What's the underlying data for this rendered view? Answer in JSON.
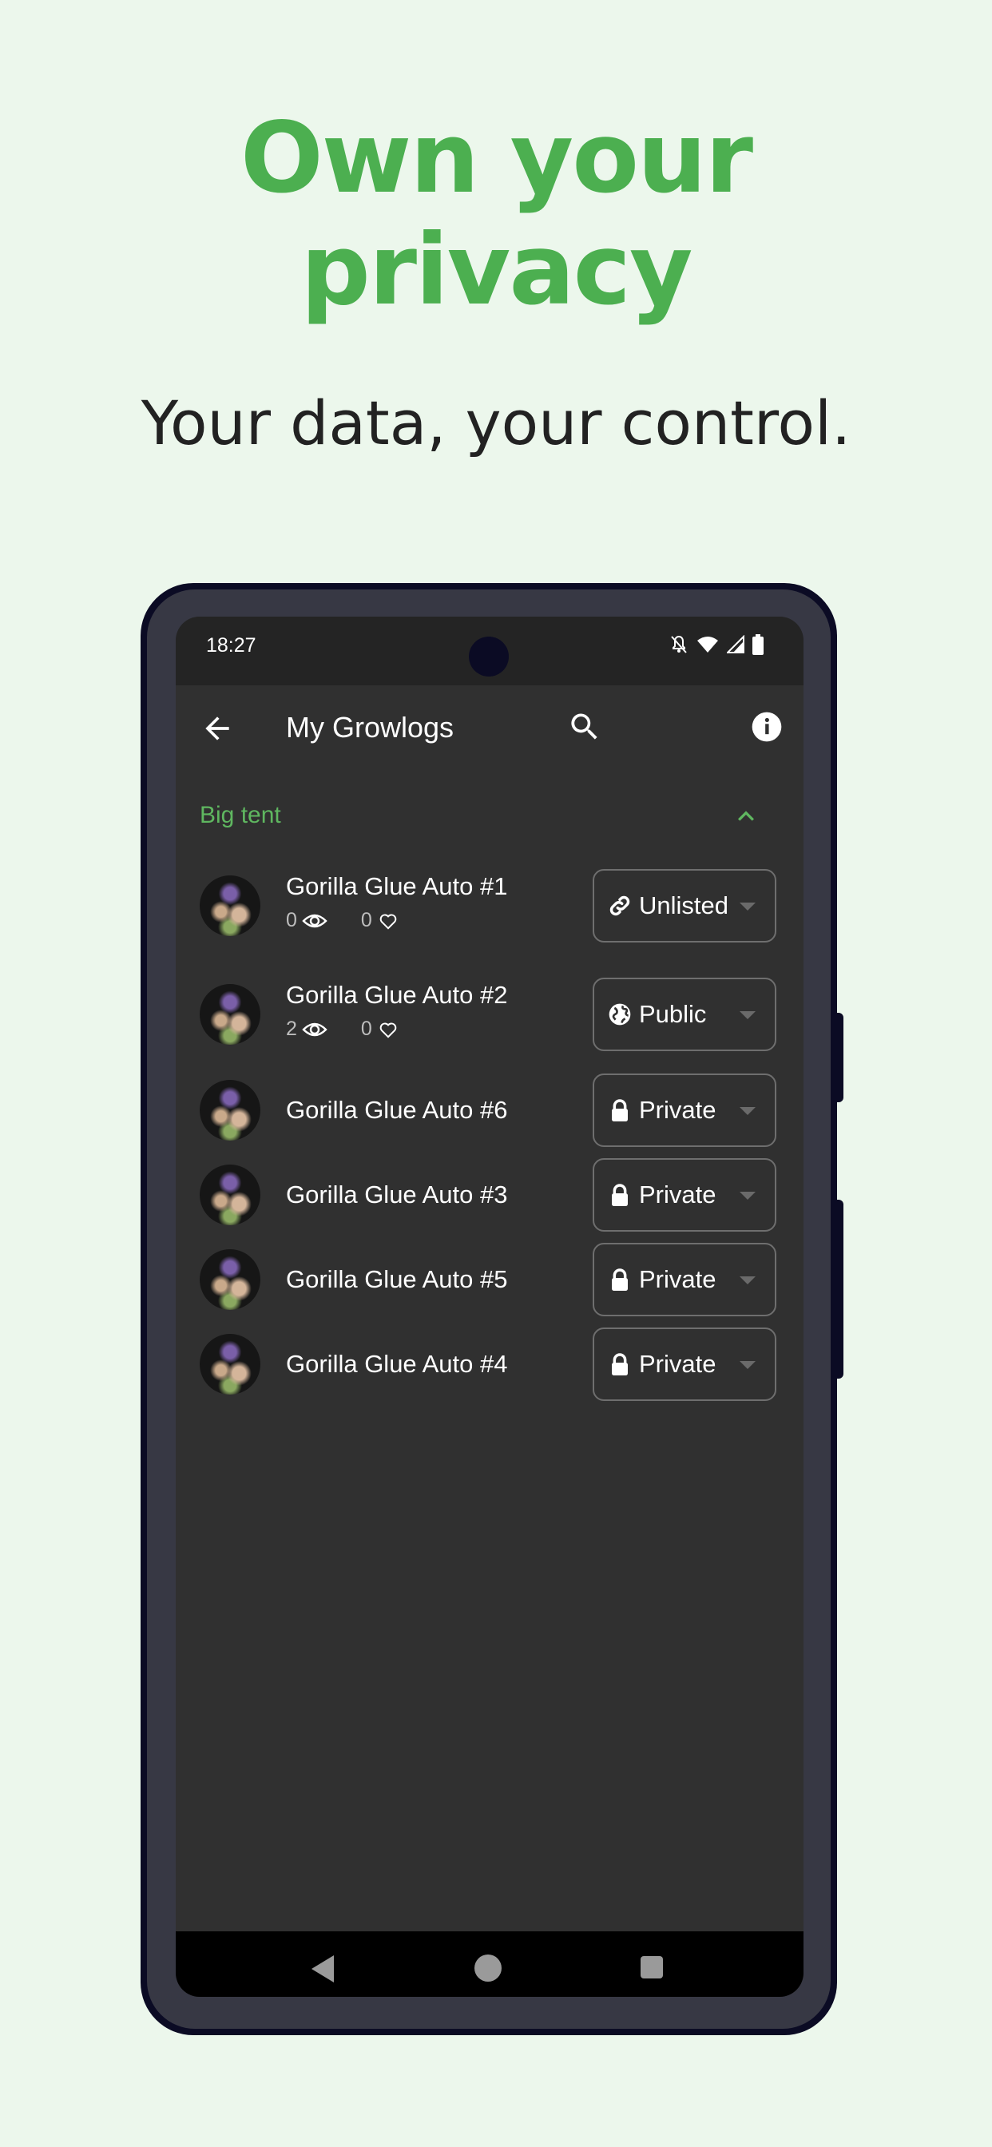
{
  "promo": {
    "headline_line1": "Own your",
    "headline_line2": "privacy",
    "subtitle": "Your data, your control."
  },
  "colors": {
    "brand_green": "#4caf50",
    "background": "#ecf7ec",
    "screen_bg": "#303030",
    "section_green": "#5fb760"
  },
  "statusbar": {
    "time": "18:27",
    "icons": [
      "notifications-off-icon",
      "wifi-icon",
      "cellular-signal-icon",
      "battery-icon"
    ]
  },
  "appbar": {
    "title": "My Growlogs",
    "back_icon": "arrow-back-icon",
    "search_icon": "search-icon",
    "info_icon": "info-icon"
  },
  "section": {
    "label": "Big tent",
    "expanded": true
  },
  "growlogs": [
    {
      "name": "Gorilla Glue Auto #1",
      "views": "0",
      "likes": "0",
      "show_stats": true,
      "visibility": "Unlisted",
      "visibility_icon": "link-icon"
    },
    {
      "name": "Gorilla Glue Auto #2",
      "views": "2",
      "likes": "0",
      "show_stats": true,
      "visibility": "Public",
      "visibility_icon": "globe-icon"
    },
    {
      "name": "Gorilla Glue Auto #6",
      "show_stats": false,
      "visibility": "Private",
      "visibility_icon": "lock-icon"
    },
    {
      "name": "Gorilla Glue Auto #3",
      "show_stats": false,
      "visibility": "Private",
      "visibility_icon": "lock-icon"
    },
    {
      "name": "Gorilla Glue Auto #5",
      "show_stats": false,
      "visibility": "Private",
      "visibility_icon": "lock-icon"
    },
    {
      "name": "Gorilla Glue Auto #4",
      "show_stats": false,
      "visibility": "Private",
      "visibility_icon": "lock-icon"
    }
  ],
  "navbar": {
    "back": "nav-back-icon",
    "home": "nav-home-icon",
    "recents": "nav-recents-icon"
  }
}
